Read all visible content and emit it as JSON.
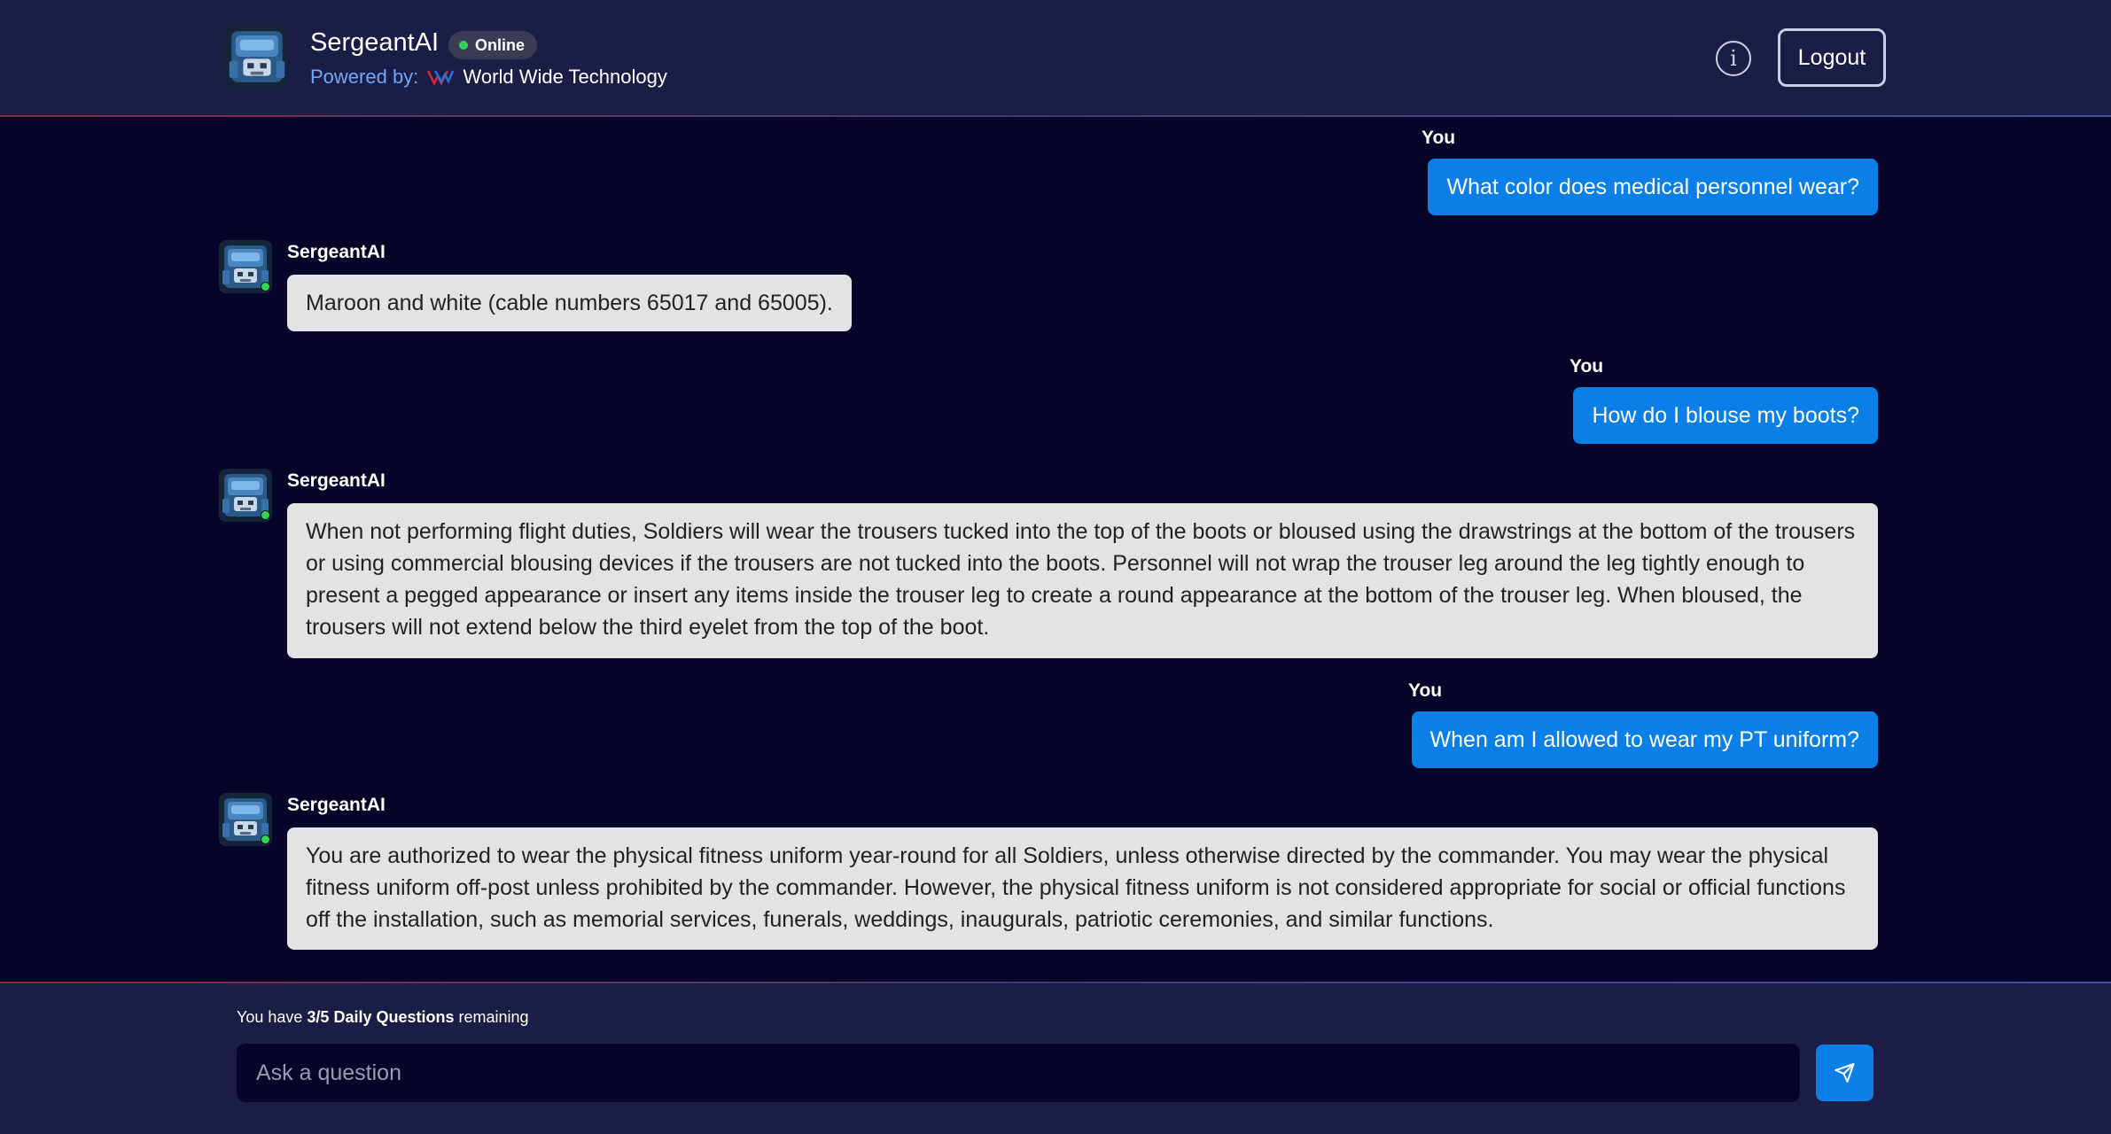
{
  "header": {
    "title": "SergeantAI",
    "status": "Online",
    "powered_label": "Powered by:",
    "company": "World Wide Technology",
    "logout_label": "Logout",
    "info_icon": "info-icon"
  },
  "messages": [
    {
      "sender": "You",
      "text": "What color does medical personnel wear?"
    },
    {
      "sender": "SergeantAI",
      "text": "Maroon and white (cable numbers 65017 and 65005)."
    },
    {
      "sender": "You",
      "text": "How do I blouse my boots?"
    },
    {
      "sender": "SergeantAI",
      "text": "When not performing flight duties, Soldiers will wear the trousers tucked into the top of the boots or bloused using the drawstrings at the bottom of the trousers or using commercial blousing devices if the trousers are not tucked into the boots. Personnel will not wrap the trouser leg around the leg tightly enough to present a pegged appearance or insert any items inside the trouser leg to create a round appearance at the bottom of the trouser leg. When bloused, the trousers will not extend below the third eyelet from the top of the boot."
    },
    {
      "sender": "You",
      "text": "When am I allowed to wear my PT uniform?"
    },
    {
      "sender": "SergeantAI",
      "text": "You are authorized to wear the physical fitness uniform year-round for all Soldiers, unless otherwise directed by the commander. You may wear the physical fitness uniform off-post unless prohibited by the commander. However, the physical fitness uniform is not considered appropriate for social or official functions off the installation, such as memorial services, funerals, weddings, inaugurals, patriotic ceremonies, and similar functions."
    }
  ],
  "footer": {
    "quota_prefix": "You have ",
    "quota_count": "3/5 Daily Questions",
    "quota_suffix": " remaining",
    "input_placeholder": "Ask a question",
    "input_value": "",
    "send_icon": "send-icon"
  },
  "colors": {
    "background": "#070529",
    "header_bg": "#1b1d46",
    "user_bubble": "#0a7fe8",
    "bot_bubble": "#e3e3e6",
    "online": "#34d058",
    "powered_by": "#6ea8ff"
  }
}
